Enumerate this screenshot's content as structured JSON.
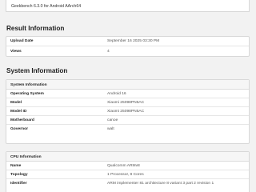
{
  "header": {
    "version_text": "Geekbench 6.3.0 for Android AArch64"
  },
  "result_information": {
    "title": "Result Information",
    "rows": [
      {
        "label": "Upload Date",
        "value": "September 16 2025 03:30 PM"
      },
      {
        "label": "Views",
        "value": "4"
      }
    ]
  },
  "system_information": {
    "title": "System Information",
    "system_card": {
      "title": "System Information",
      "rows": [
        {
          "label": "Operating System",
          "value": "Android 16"
        },
        {
          "label": "Model",
          "value": "Xiaomi 25098PN5AC"
        },
        {
          "label": "Model ID",
          "value": "Xiaomi 25098PN5AC"
        },
        {
          "label": "Motherboard",
          "value": "canoe"
        },
        {
          "label": "Governor",
          "value": "walt"
        }
      ]
    },
    "cpu_card": {
      "title": "CPU Information",
      "rows": [
        {
          "label": "Name",
          "value": "Qualcomm ARMv8"
        },
        {
          "label": "Topology",
          "value": "1 Processor, 8 Cores"
        },
        {
          "label": "Identifier",
          "value": "ARM implementer 81 architecture 8 variant 3 part 2 revision 1"
        }
      ]
    }
  }
}
